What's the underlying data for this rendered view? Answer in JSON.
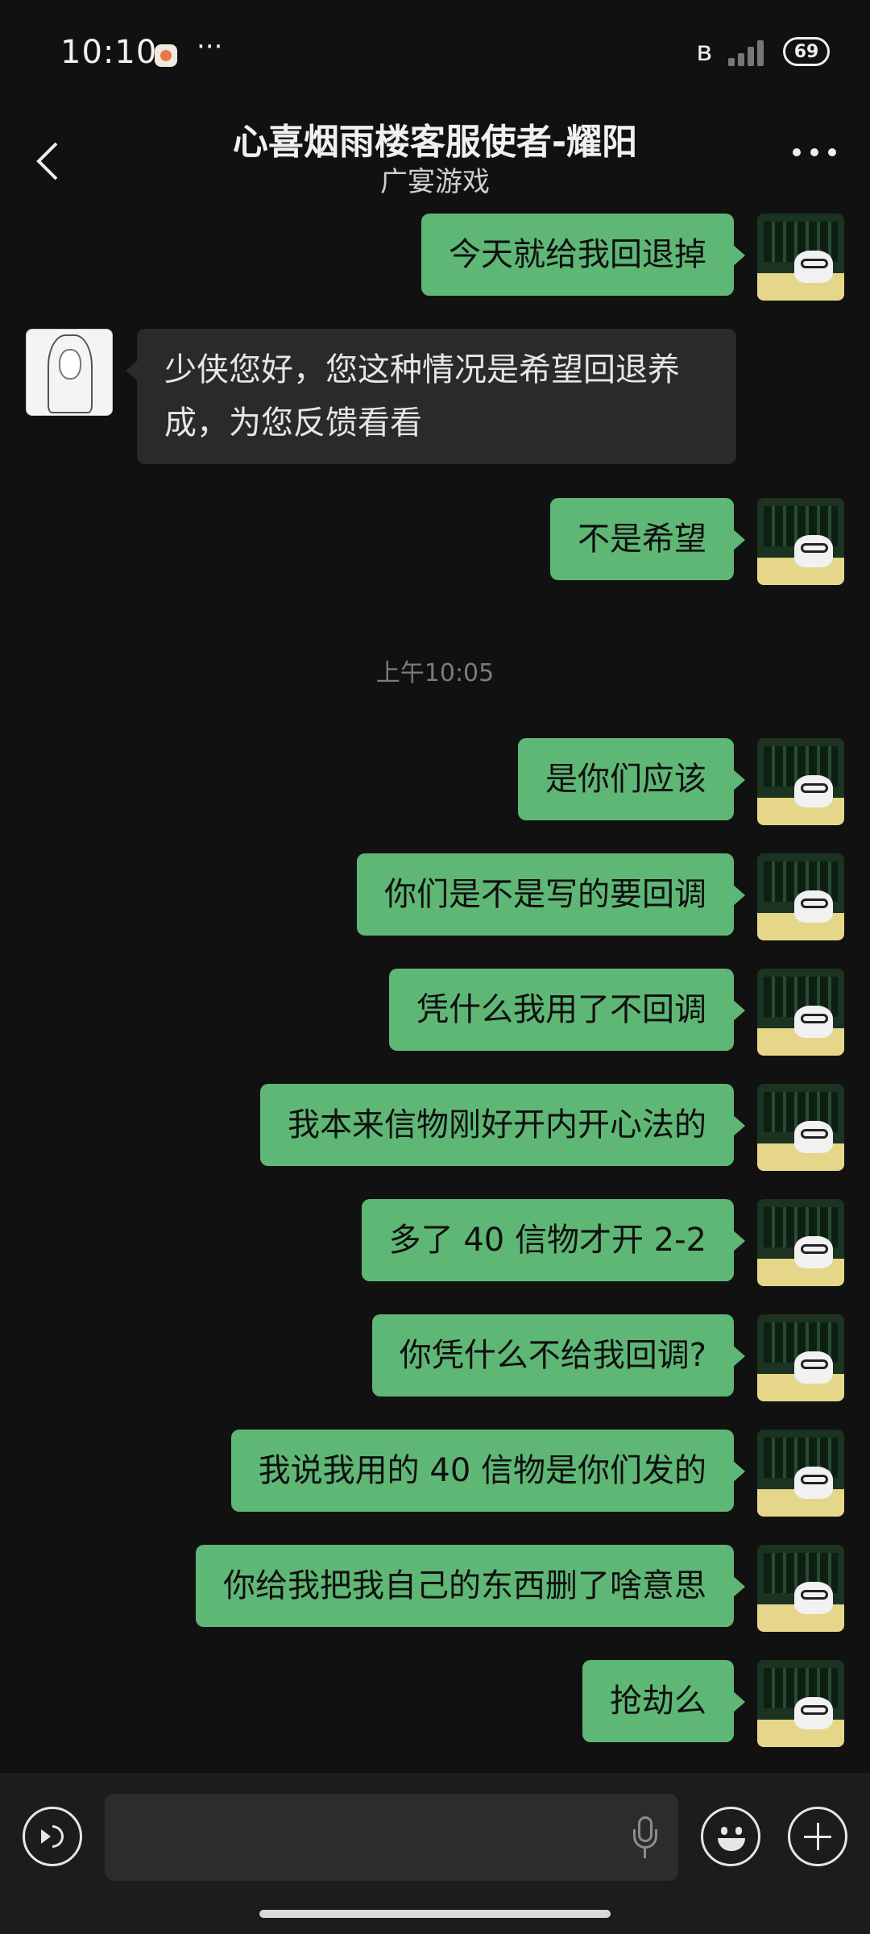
{
  "status_bar": {
    "time": "10:10",
    "notification_icon": "app-notification-icon",
    "more_dots": "···",
    "bluetooth_icon": "bluetooth-icon",
    "signal_icon": "signal-icon",
    "battery_level": "69"
  },
  "header": {
    "title": "心喜烟雨楼客服使者-耀阳",
    "subtitle": "广宴游戏"
  },
  "messages": [
    {
      "side": "right",
      "text": "今天就给我回退掉"
    },
    {
      "side": "left",
      "text": "少侠您好，您这种情况是希望回退养成，为您反馈看看"
    },
    {
      "side": "right",
      "text": "不是希望"
    },
    {
      "timestamp": "上午10:05"
    },
    {
      "side": "right",
      "text": "是你们应该"
    },
    {
      "side": "right",
      "text": "你们是不是写的要回调"
    },
    {
      "side": "right",
      "text": "凭什么我用了不回调"
    },
    {
      "side": "right",
      "text": "我本来信物刚好开内开心法的"
    },
    {
      "side": "right",
      "text": "多了 40 信物才开 2-2"
    },
    {
      "side": "right",
      "text": "你凭什么不给我回调?"
    },
    {
      "side": "right",
      "text": "我说我用的 40 信物是你们发的"
    },
    {
      "side": "right",
      "text": "你给我把我自己的东西删了啥意思"
    },
    {
      "side": "right",
      "text": "抢劫么"
    }
  ],
  "input_bar": {
    "text_value": "",
    "voice_icon": "voice-input-icon",
    "mic_icon": "microphone-icon",
    "emoji_icon": "emoji-icon",
    "plus_icon": "plus-icon"
  },
  "colors": {
    "background": "#111111",
    "self_bubble": "#5fb776",
    "other_bubble": "#2a2a2a",
    "input_bar": "#1c1c1c"
  }
}
